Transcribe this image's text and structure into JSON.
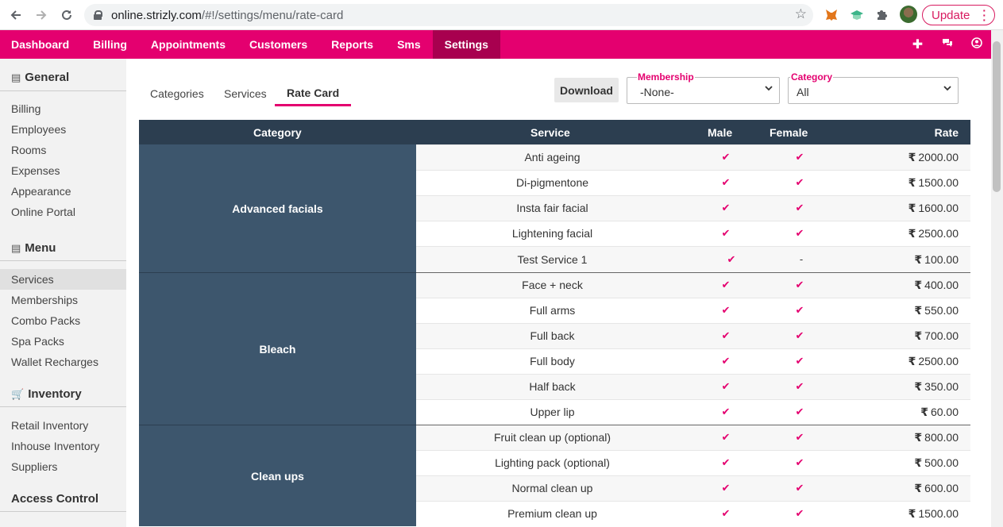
{
  "browser": {
    "url_host": "online.strizly.com",
    "url_path": "/#!/settings/menu/rate-card",
    "update_label": "Update"
  },
  "topnav": {
    "items": [
      "Dashboard",
      "Billing",
      "Appointments",
      "Customers",
      "Reports",
      "Sms",
      "Settings"
    ],
    "active": "Settings",
    "right_icons": [
      "plus-icon",
      "chat-icon",
      "user-icon"
    ]
  },
  "sidebar": {
    "general": {
      "title": "General",
      "items": [
        "Billing",
        "Employees",
        "Rooms",
        "Expenses",
        "Appearance",
        "Online Portal"
      ]
    },
    "menu": {
      "title": "Menu",
      "items": [
        "Services",
        "Memberships",
        "Combo Packs",
        "Spa Packs",
        "Wallet Recharges"
      ],
      "active": "Services"
    },
    "inventory": {
      "title": "Inventory",
      "items": [
        "Retail Inventory",
        "Inhouse Inventory",
        "Suppliers"
      ]
    },
    "access": {
      "title": "Access Control"
    }
  },
  "tabs": [
    "Categories",
    "Services",
    "Rate Card"
  ],
  "active_tab": "Rate Card",
  "download_label": "Download",
  "membership": {
    "legend": "Membership",
    "value": "-None-"
  },
  "category": {
    "legend": "Category",
    "value": "All"
  },
  "table": {
    "headers": {
      "category": "Category",
      "service": "Service",
      "male": "Male",
      "female": "Female",
      "rate": "Rate"
    },
    "currency": "₹",
    "check": "✔",
    "dash": "-",
    "groups": [
      {
        "category": "Advanced facials",
        "rows": [
          {
            "service": "Anti ageing",
            "male": true,
            "female": true,
            "rate": "2000.00"
          },
          {
            "service": "Di-pigmentone",
            "male": true,
            "female": true,
            "rate": "1500.00"
          },
          {
            "service": "Insta fair facial",
            "male": true,
            "female": true,
            "rate": "1600.00"
          },
          {
            "service": "Lightening facial",
            "male": true,
            "female": true,
            "rate": "2500.00"
          },
          {
            "service": "Test Service 1",
            "male": true,
            "female": false,
            "rate": "100.00"
          }
        ]
      },
      {
        "category": "Bleach",
        "rows": [
          {
            "service": "Face + neck",
            "male": true,
            "female": true,
            "rate": "400.00"
          },
          {
            "service": "Full arms",
            "male": true,
            "female": true,
            "rate": "550.00"
          },
          {
            "service": "Full back",
            "male": true,
            "female": true,
            "rate": "700.00"
          },
          {
            "service": "Full body",
            "male": true,
            "female": true,
            "rate": "2500.00"
          },
          {
            "service": "Half back",
            "male": true,
            "female": true,
            "rate": "350.00"
          },
          {
            "service": "Upper lip",
            "male": true,
            "female": true,
            "rate": "60.00"
          }
        ]
      },
      {
        "category": "Clean ups",
        "rows": [
          {
            "service": "Fruit clean up (optional)",
            "male": true,
            "female": true,
            "rate": "800.00"
          },
          {
            "service": "Lighting pack (optional)",
            "male": true,
            "female": true,
            "rate": "500.00"
          },
          {
            "service": "Normal clean up",
            "male": true,
            "female": true,
            "rate": "600.00"
          },
          {
            "service": "Premium clean up",
            "male": true,
            "female": true,
            "rate": "1500.00"
          }
        ]
      }
    ]
  }
}
